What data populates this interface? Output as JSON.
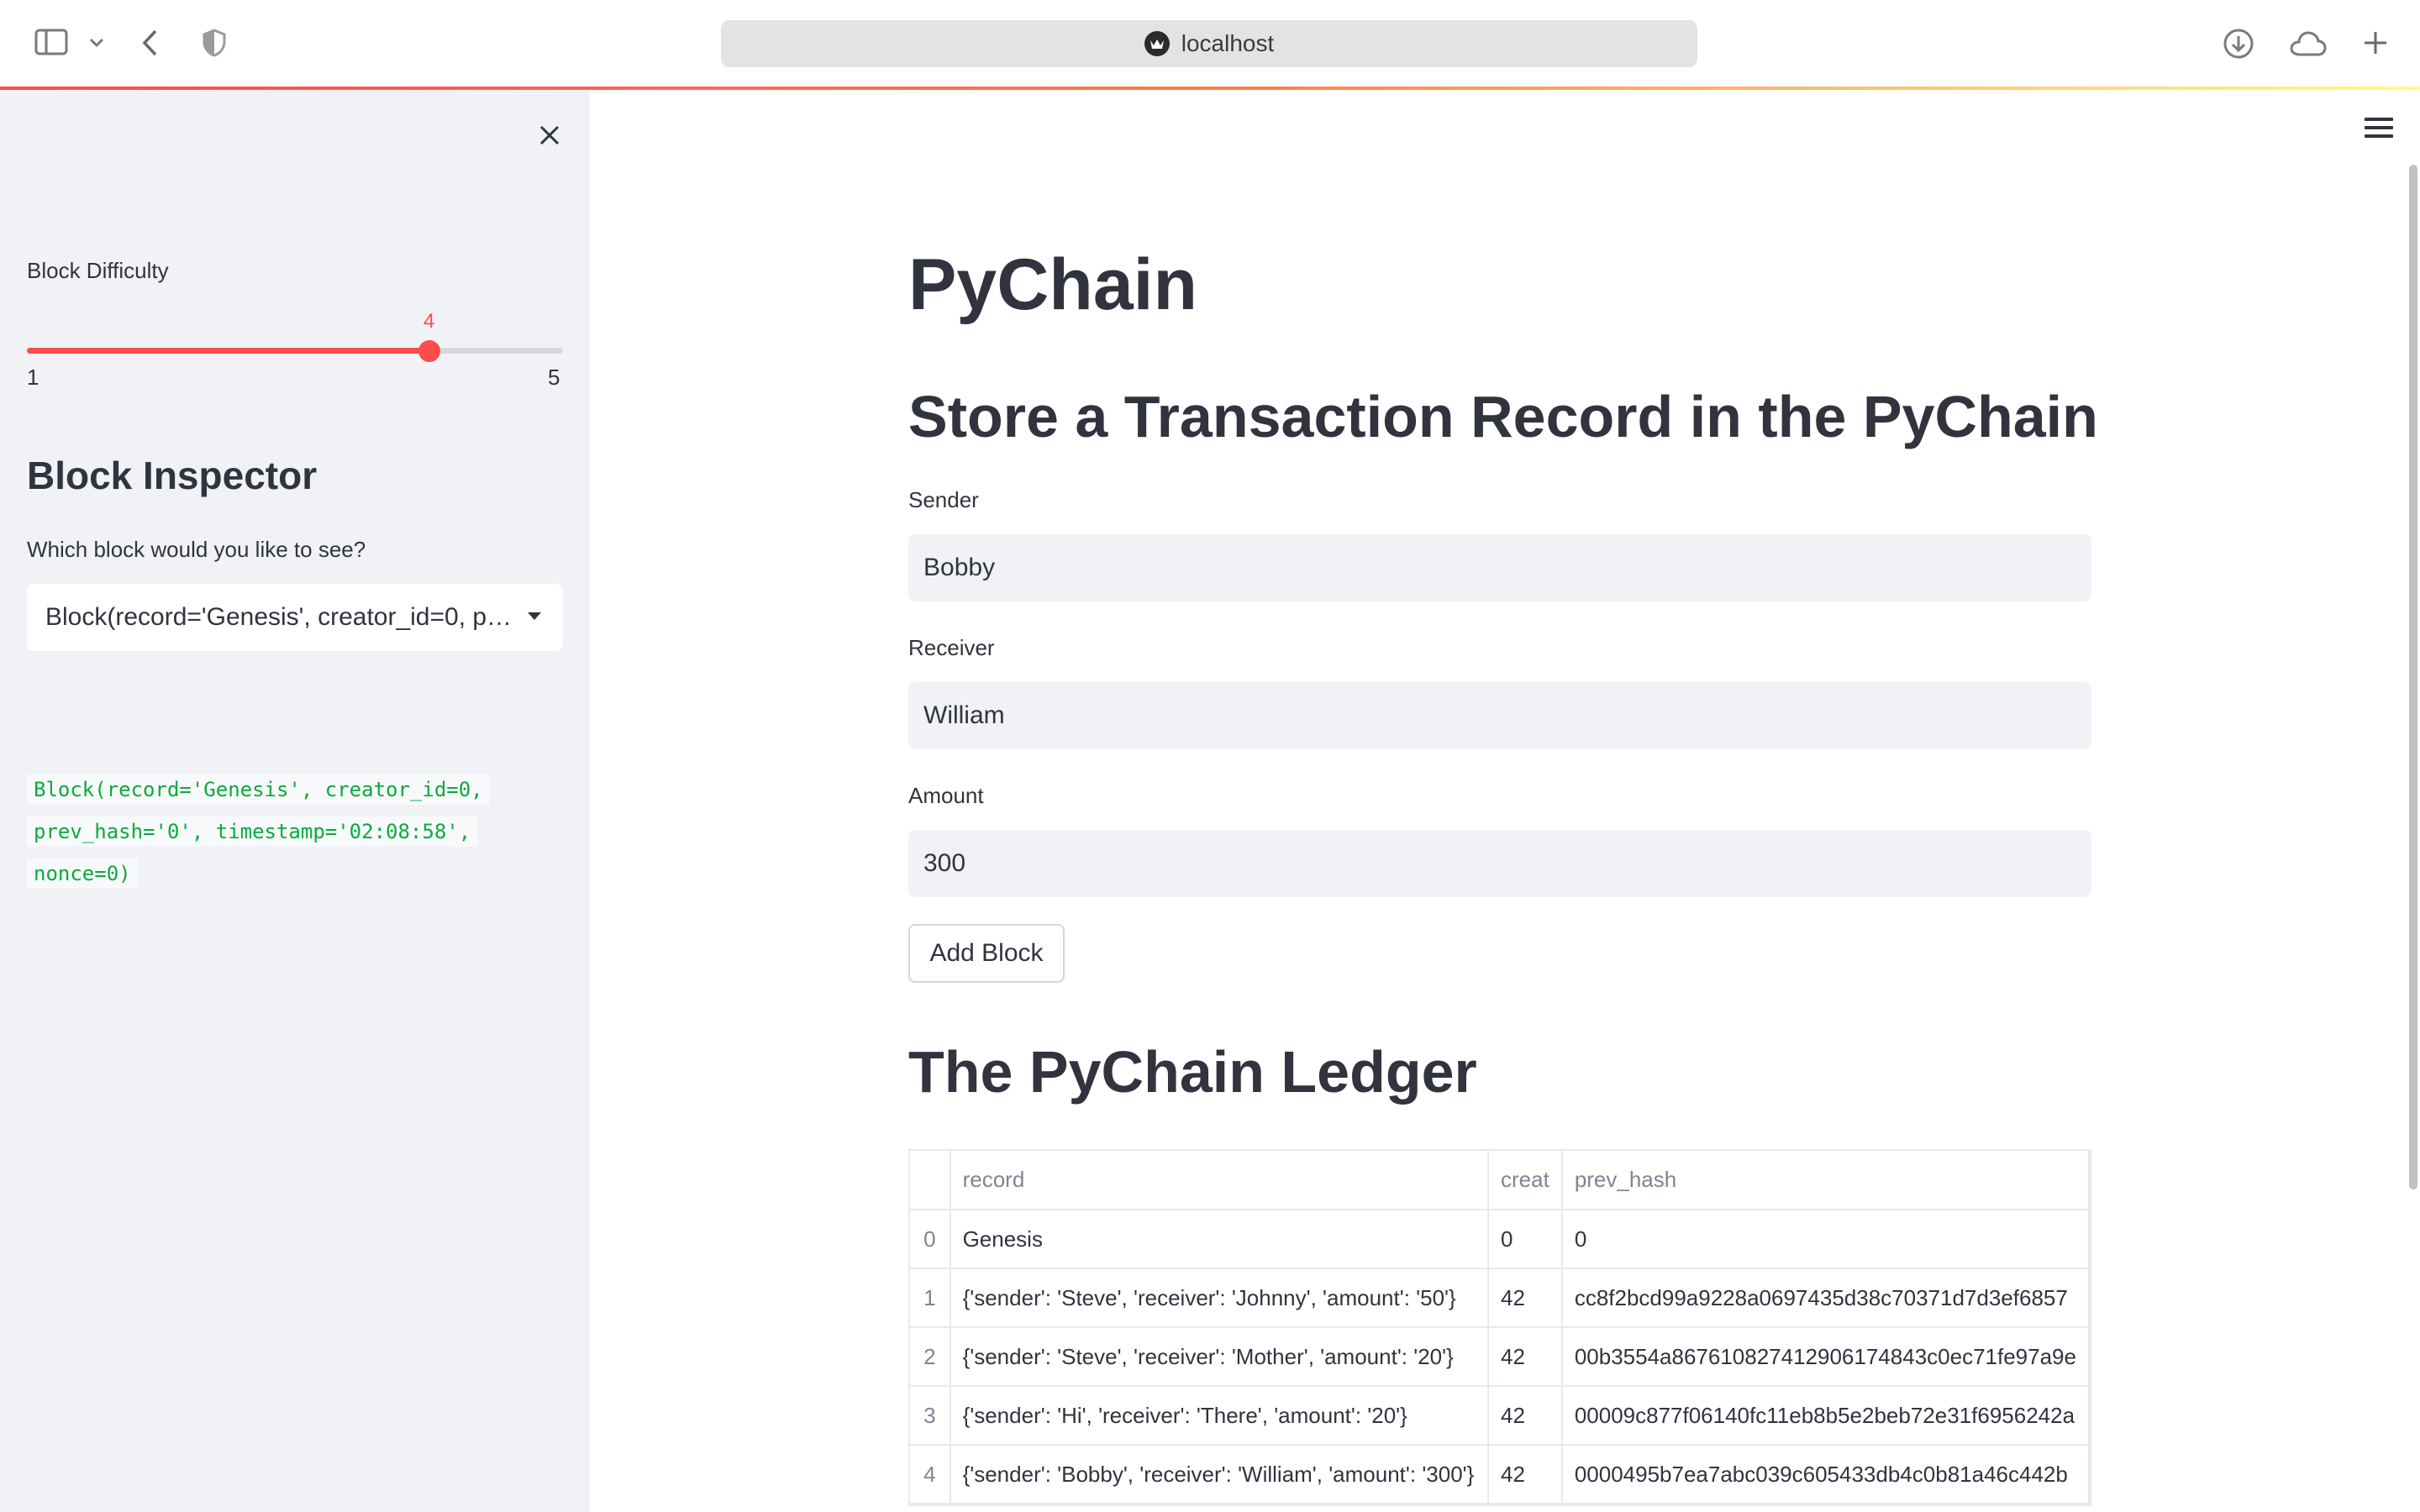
{
  "browser": {
    "url": "localhost",
    "colors": {
      "gradient_start": "#ff4b4b",
      "gradient_end": "#fffd80"
    }
  },
  "sidebar": {
    "slider": {
      "label": "Block Difficulty",
      "value": 4,
      "min": 1,
      "max": 5,
      "value_text": "4",
      "min_text": "1",
      "max_text": "5"
    },
    "inspector_title": "Block Inspector",
    "select_label": "Which block would you like to see?",
    "select_value": "Block(record='Genesis', creator_id=0, prev_hash='0', timestamp='02:08:58', nonce=0)",
    "code_lines": [
      "Block(record='Genesis', creator_id=0,",
      "prev_hash='0', timestamp='02:08:58',",
      "nonce=0)"
    ]
  },
  "main": {
    "title": "PyChain",
    "form_title": "Store a Transaction Record in the PyChain",
    "sender": {
      "label": "Sender",
      "value": "Bobby"
    },
    "receiver": {
      "label": "Receiver",
      "value": "William"
    },
    "amount": {
      "label": "Amount",
      "value": "300"
    },
    "add_button": "Add Block",
    "ledger_title": "The PyChain Ledger",
    "ledger": {
      "columns": [
        "",
        "record",
        "creat",
        "prev_hash"
      ],
      "rows": [
        {
          "index": "0",
          "record": "Genesis",
          "creator": "0",
          "prev_hash": "0"
        },
        {
          "index": "1",
          "record": "{'sender': 'Steve', 'receiver': 'Johnny', 'amount': '50'}",
          "creator": "42",
          "prev_hash": "cc8f2bcd99a9228a0697435d38c70371d7d3ef6857"
        },
        {
          "index": "2",
          "record": "{'sender': 'Steve', 'receiver': 'Mother', 'amount': '20'}",
          "creator": "42",
          "prev_hash": "00b3554a867610827412906174843c0ec71fe97a9e"
        },
        {
          "index": "3",
          "record": "{'sender': 'Hi', 'receiver': 'There', 'amount': '20'}",
          "creator": "42",
          "prev_hash": "00009c877f06140fc11eb8b5e2beb72e31f6956242a"
        },
        {
          "index": "4",
          "record": "{'sender': 'Bobby', 'receiver': 'William', 'amount': '300'}",
          "creator": "42",
          "prev_hash": "0000495b7ea7abc039c605433db4c0b81a46c442b"
        }
      ]
    }
  }
}
